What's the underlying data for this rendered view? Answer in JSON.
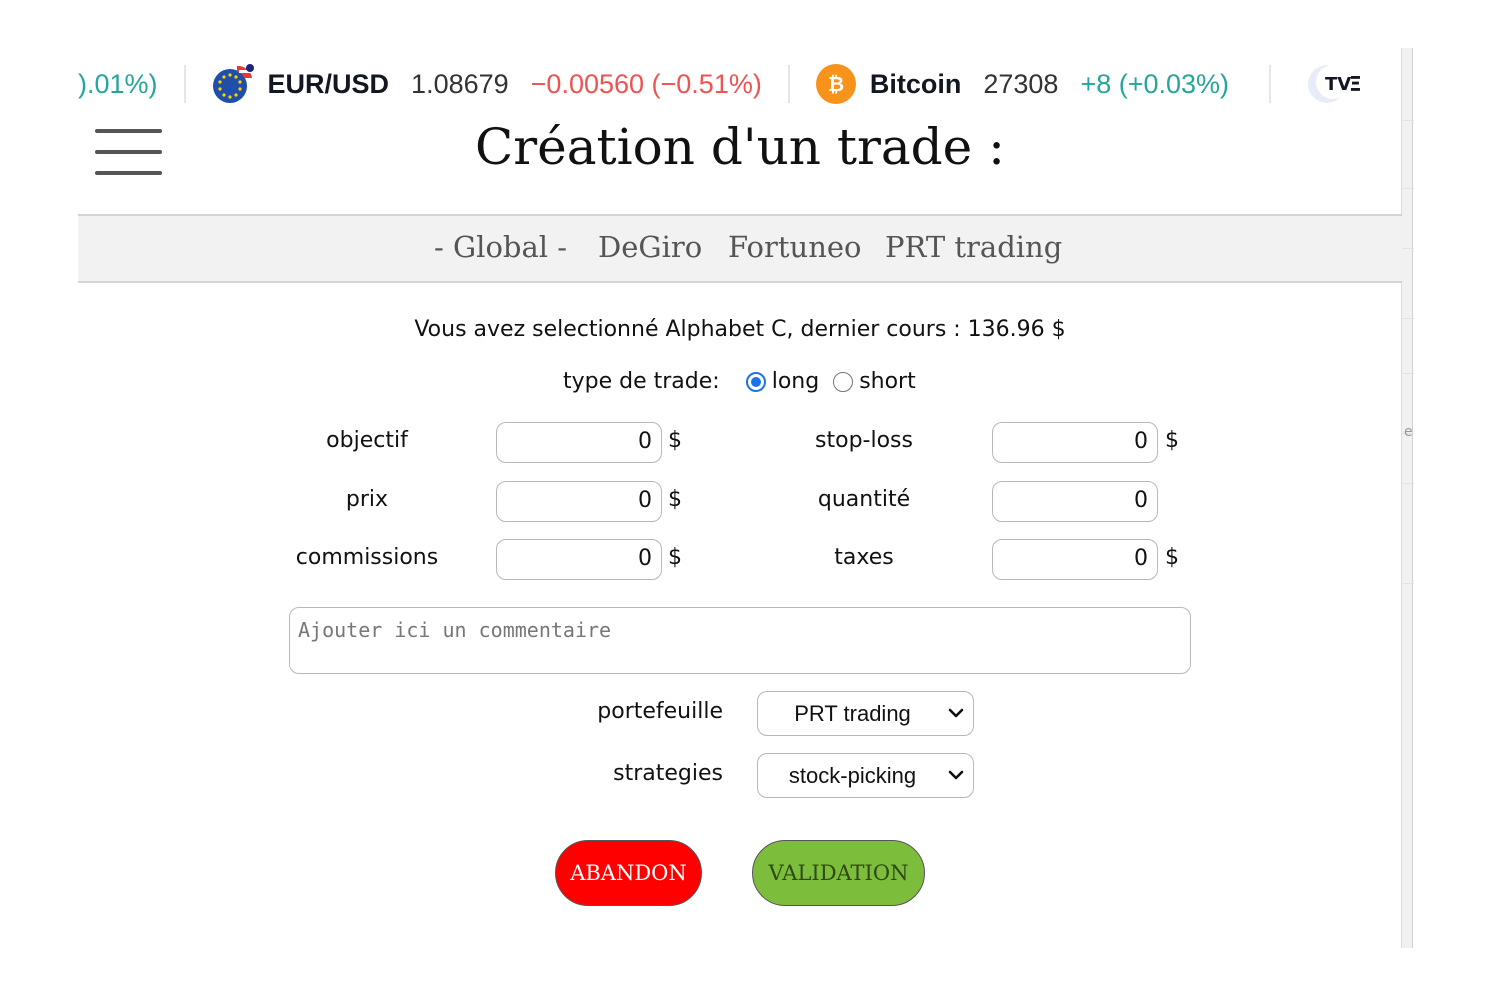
{
  "ticker": {
    "partial_change": ").01%)",
    "items": [
      {
        "name": "EUR/USD",
        "price": "1.08679",
        "change": "−0.00560 (−0.51%)",
        "direction": "down",
        "icon": "eu-us-flag-icon"
      },
      {
        "name": "Bitcoin",
        "price": "27308",
        "change": "+8 (+0.03%)",
        "direction": "up",
        "icon": "bitcoin-icon"
      }
    ],
    "partial_logo": "TV",
    "colors": {
      "up": "#26a69a",
      "down": "#ef5350",
      "bitcoin": "#f7931a"
    }
  },
  "header": {
    "title": "Création d'un trade :"
  },
  "tabs": [
    "- Global -",
    "DeGiro",
    "Fortuneo",
    "PRT trading"
  ],
  "form": {
    "info": "Vous avez selectionné Alphabet C, dernier cours : 136.96 $",
    "trade_type": {
      "label": "type de trade:",
      "options": [
        "long",
        "short"
      ],
      "selected": "long"
    },
    "fields": {
      "objectif": {
        "label": "objectif",
        "value": "0",
        "unit": "$"
      },
      "stop_loss": {
        "label": "stop-loss",
        "value": "0",
        "unit": "$"
      },
      "prix": {
        "label": "prix",
        "value": "0",
        "unit": "$"
      },
      "quantite": {
        "label": "quantité",
        "value": "0"
      },
      "commissions": {
        "label": "commissions",
        "value": "0",
        "unit": "$"
      },
      "taxes": {
        "label": "taxes",
        "value": "0",
        "unit": "$"
      }
    },
    "comment_placeholder": "Ajouter ici un commentaire",
    "portefeuille": {
      "label": "portefeuille",
      "value": "PRT trading"
    },
    "strategies": {
      "label": "strategies",
      "value": "stock-picking"
    },
    "buttons": {
      "abandon": "ABANDON",
      "validation": "VALIDATION"
    }
  },
  "colors": {
    "abandon": "#ff0000",
    "validation": "#7cbe3c",
    "radio_selected": "#1a73e8"
  }
}
